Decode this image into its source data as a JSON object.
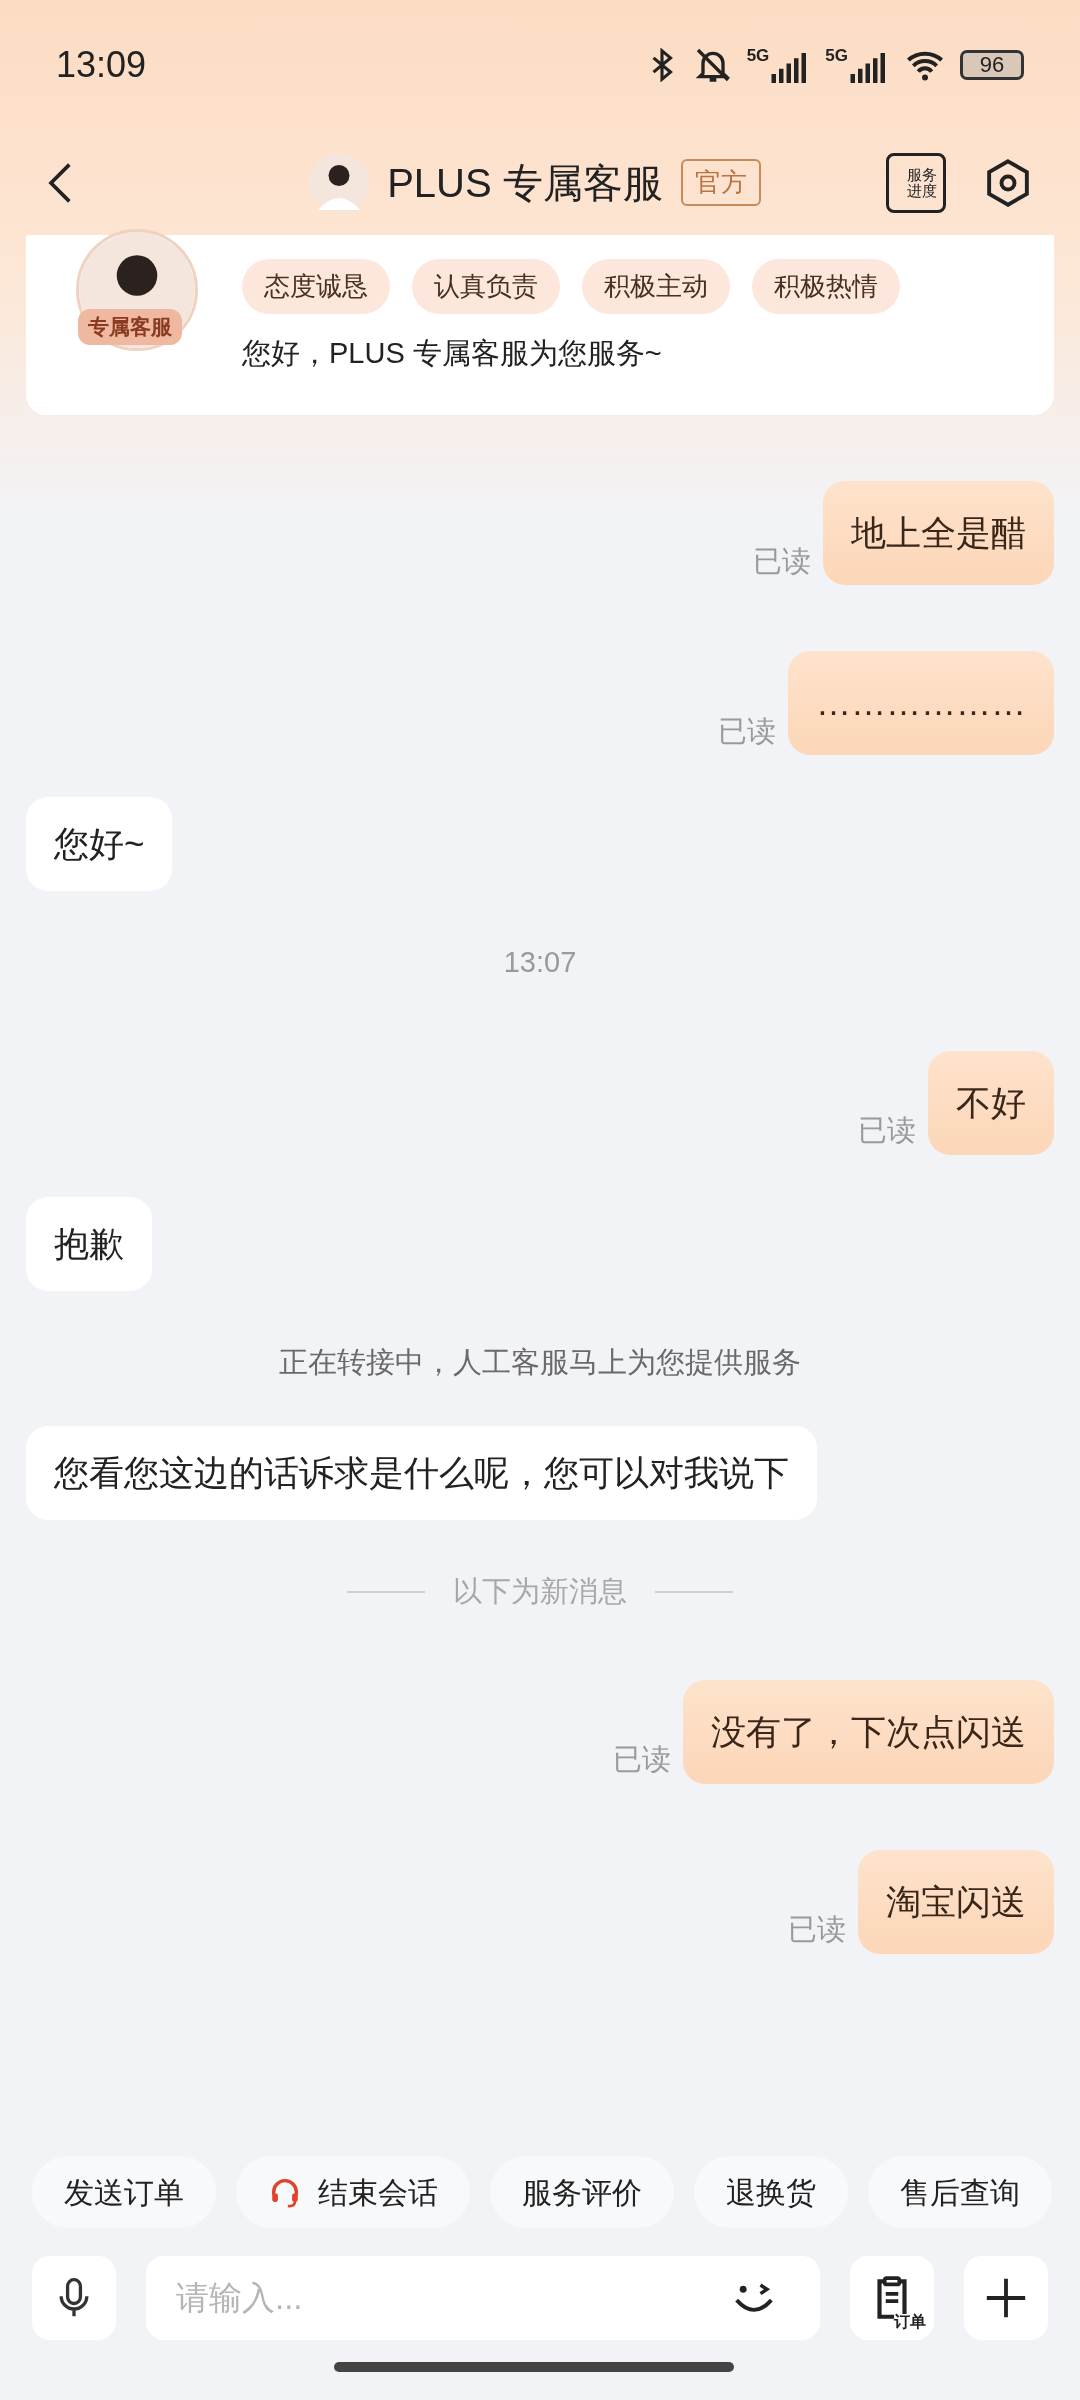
{
  "status_bar": {
    "time": "13:09",
    "network": [
      "5G",
      "5G"
    ],
    "battery": "96"
  },
  "header": {
    "title": "PLUS 专属客服",
    "badge": "官方",
    "progress_label": "服务进度"
  },
  "agent_card": {
    "avatar_label": "专属客服",
    "tags": [
      "态度诚恳",
      "认真负责",
      "积极主动",
      "积极热情"
    ],
    "greeting": "您好，PLUS 专属客服为您服务~"
  },
  "messages": [
    {
      "kind": "outgoing",
      "text": "地上全是醋",
      "status": "已读"
    },
    {
      "kind": "outgoing",
      "text": "………………",
      "status": "已读"
    },
    {
      "kind": "incoming",
      "text": "您好~"
    },
    {
      "kind": "time",
      "text": "13:07"
    },
    {
      "kind": "outgoing",
      "text": "不好",
      "status": "已读"
    },
    {
      "kind": "incoming",
      "text": "抱歉"
    },
    {
      "kind": "system",
      "text": "正在转接中，人工客服马上为您提供服务"
    },
    {
      "kind": "incoming",
      "text": "您看您这边的话诉求是什么呢，您可以对我说下"
    },
    {
      "kind": "divider",
      "text": "以下为新消息"
    },
    {
      "kind": "outgoing",
      "text": "没有了，下次点闪送",
      "status": "已读"
    },
    {
      "kind": "outgoing",
      "text": "淘宝闪送",
      "status": "已读"
    }
  ],
  "quick_actions": [
    {
      "label": "发送订单",
      "icon": false
    },
    {
      "label": "结束会话",
      "icon": true
    },
    {
      "label": "服务评价",
      "icon": false
    },
    {
      "label": "退换货",
      "icon": false
    },
    {
      "label": "售后查询",
      "icon": false
    }
  ],
  "input": {
    "placeholder": "请输入...",
    "order_label": "订单"
  }
}
